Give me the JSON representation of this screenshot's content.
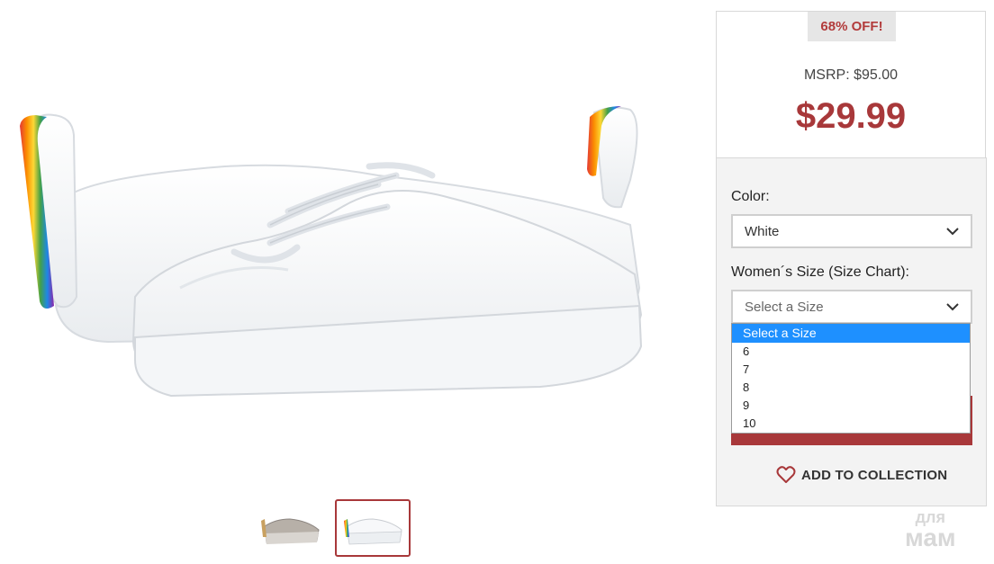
{
  "product": {
    "discount_badge": "68% OFF!",
    "msrp": "MSRP: $95.00",
    "price": "$29.99"
  },
  "options": {
    "color_label": "Color:",
    "color_value": "White",
    "size_label": "Women´s Size (Size Chart):",
    "size_value": "Select a Size",
    "size_options": [
      "Select a Size",
      "6",
      "7",
      "8",
      "9",
      "10"
    ]
  },
  "actions": {
    "add_to_collection": "ADD TO COLLECTION"
  },
  "watermark": {
    "line1": "для",
    "line2": "мам"
  },
  "icons": {
    "dropdown": "chevron-down-icon",
    "collection": "heart-icon"
  },
  "colors": {
    "accent": "#a8383a",
    "highlight": "#1e90ff"
  }
}
